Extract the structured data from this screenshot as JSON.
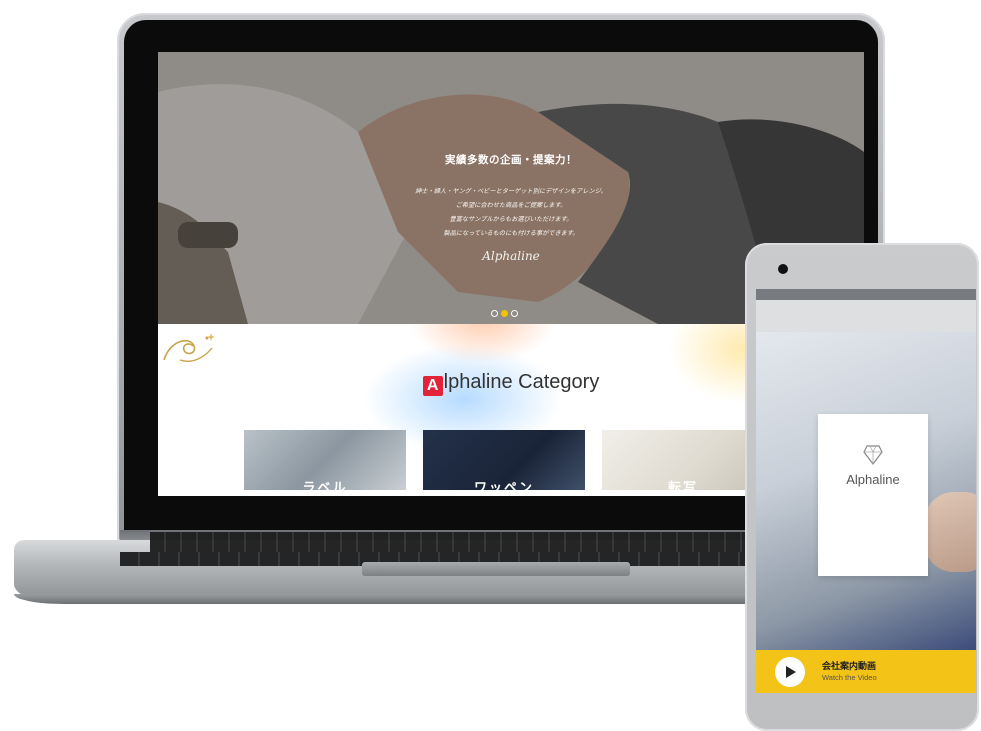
{
  "hero": {
    "title": "実績多数の企画・提案力！",
    "lines": [
      "紳士・婦人・ヤング・ベビーとターゲット別にデザインをアレンジ。",
      "ご希望に合わせた商品をご提案します。",
      "豊富なサンプルからもお選びいただけます。",
      "製品になっているものにも付ける事ができます。"
    ],
    "signature": "Alphaline",
    "slides": {
      "count": 3,
      "active_index": 1
    }
  },
  "category": {
    "badge_letter": "A",
    "title_rest": "lphaline Category",
    "cards": [
      {
        "label": "ラベル"
      },
      {
        "label": "ワッペン"
      },
      {
        "label": "転写"
      }
    ]
  },
  "phone": {
    "shirt_logo": "Alphaline",
    "cta": {
      "title": "会社案内動画",
      "subtitle": "Watch the Video"
    }
  },
  "colors": {
    "accent_yellow": "#f4c318",
    "badge_red": "#e2233a",
    "slide_dot_active": "#f2c300"
  },
  "icons": {
    "play": "play-icon",
    "ornament": "gold-swirl-ornament",
    "shirt_logo_icon": "diamond-outline-icon"
  }
}
